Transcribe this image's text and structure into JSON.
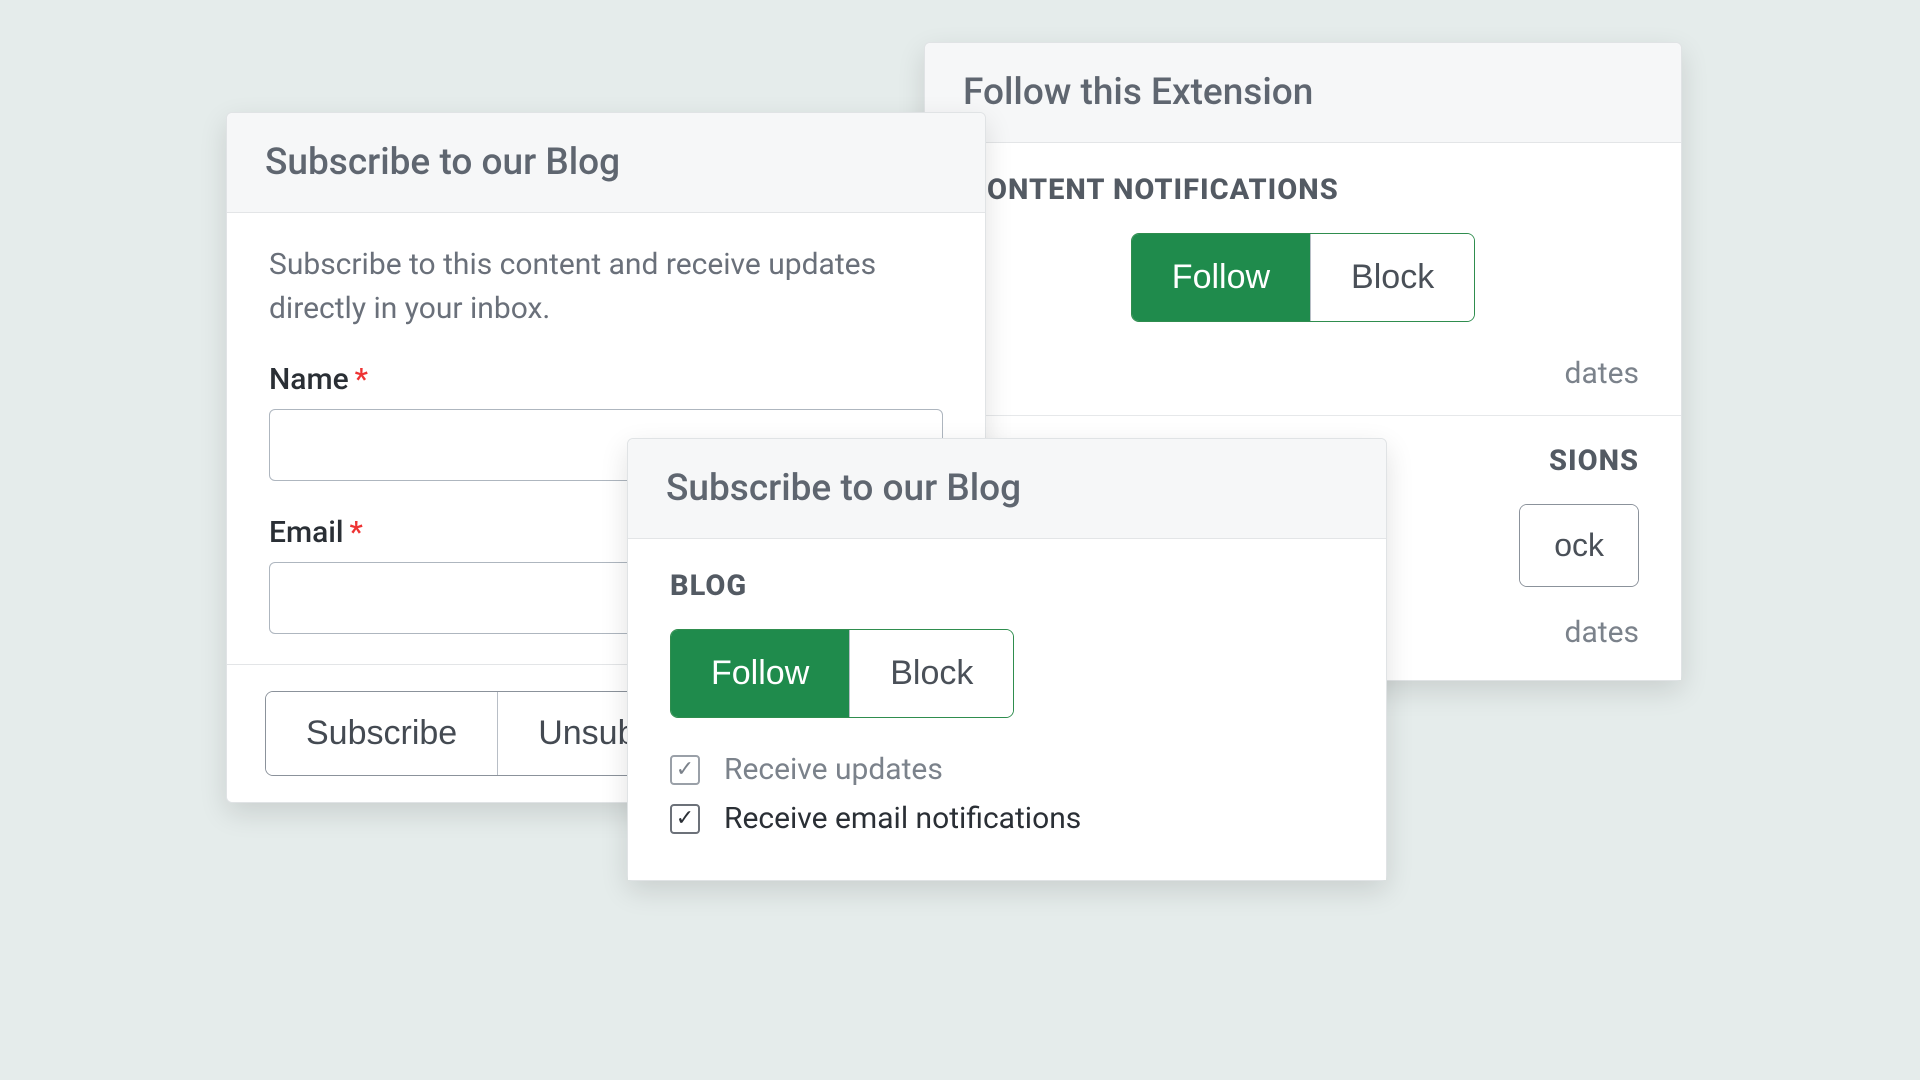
{
  "form_card": {
    "title": "Subscribe to our Blog",
    "description": "Subscribe to this content and receive updates directly in your inbox.",
    "name_label": "Name",
    "email_label": "Email",
    "required_mark": "*",
    "subscribe_label": "Subscribe",
    "unsubscribe_label": "Unsubscribe"
  },
  "ext_card": {
    "title": "Follow this Extension",
    "section1_heading": "CONTENT NOTIFICATIONS",
    "follow_label": "Follow",
    "block_label": "Block",
    "updates_fragment": "dates",
    "section2_heading_suffix": "SIONS",
    "block2_fragment": "ock",
    "updates2_fragment": "dates"
  },
  "blog_card": {
    "title": "Subscribe to our Blog",
    "section_heading": "BLOG",
    "follow_label": "Follow",
    "block_label": "Block",
    "receive_updates_label": "Receive updates",
    "receive_email_label": "Receive email notifications"
  }
}
